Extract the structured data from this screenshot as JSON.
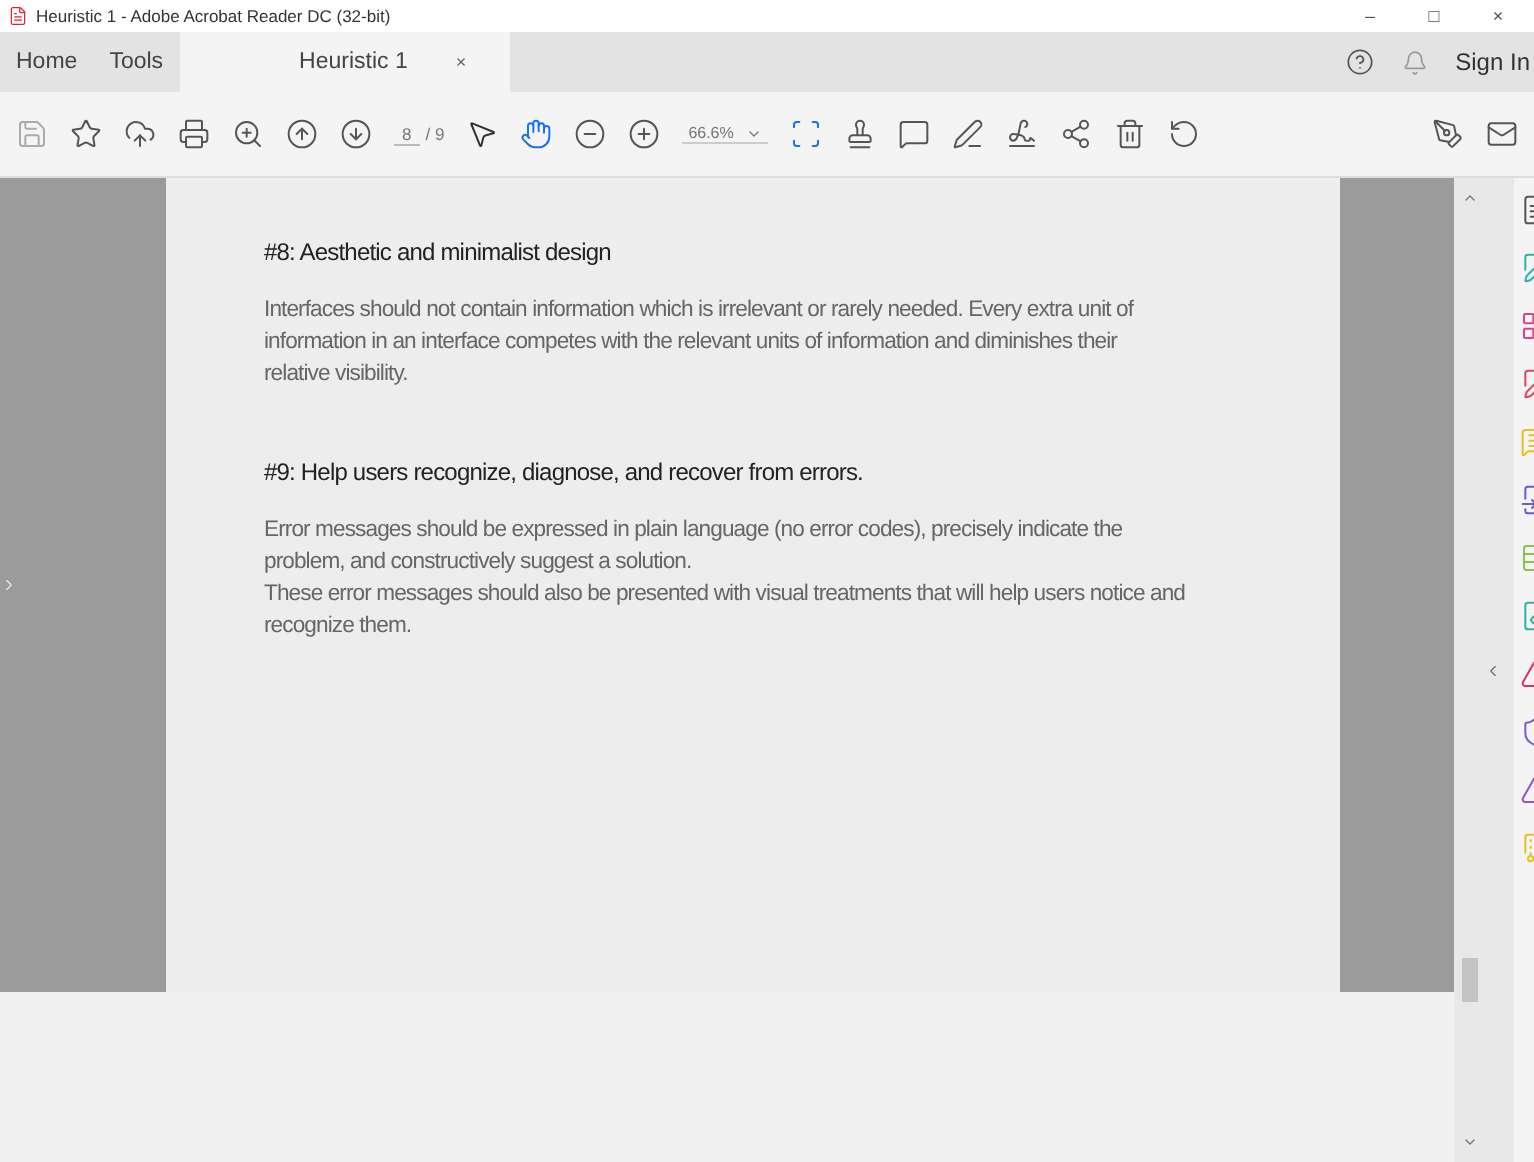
{
  "window": {
    "title": "Heuristic 1 - Adobe Acrobat Reader DC (32-bit)",
    "controls": [
      "–",
      "□",
      "×"
    ]
  },
  "tabs": [
    {
      "label": "Home",
      "selected": false
    },
    {
      "label": "Tools",
      "selected": false
    },
    {
      "label": "Heuristic 1",
      "selected": true,
      "close": "×"
    }
  ],
  "account": {
    "sign_in": "Sign In"
  },
  "toolbar": {
    "page": "8",
    "page_count": "/ 9",
    "zoom": "66.6%"
  },
  "document": {
    "sections": [
      {
        "heading": "#8: Aesthetic and minimalist design",
        "paragraphs": [
          "Interfaces should not contain information which is irrelevant or rarely needed. Every extra unit of information in an interface competes with the relevant units of information and diminishes their relative visibility."
        ]
      },
      {
        "heading": "#9: Help users recognize, diagnose, and recover from errors.",
        "paragraphs": [
          "Error messages should be expressed in plain language (no error codes), precisely indicate the problem, and constructively suggest a solution.",
          "These error messages should also be presented with visual treatments that will help users notice and recognize them."
        ]
      }
    ]
  }
}
